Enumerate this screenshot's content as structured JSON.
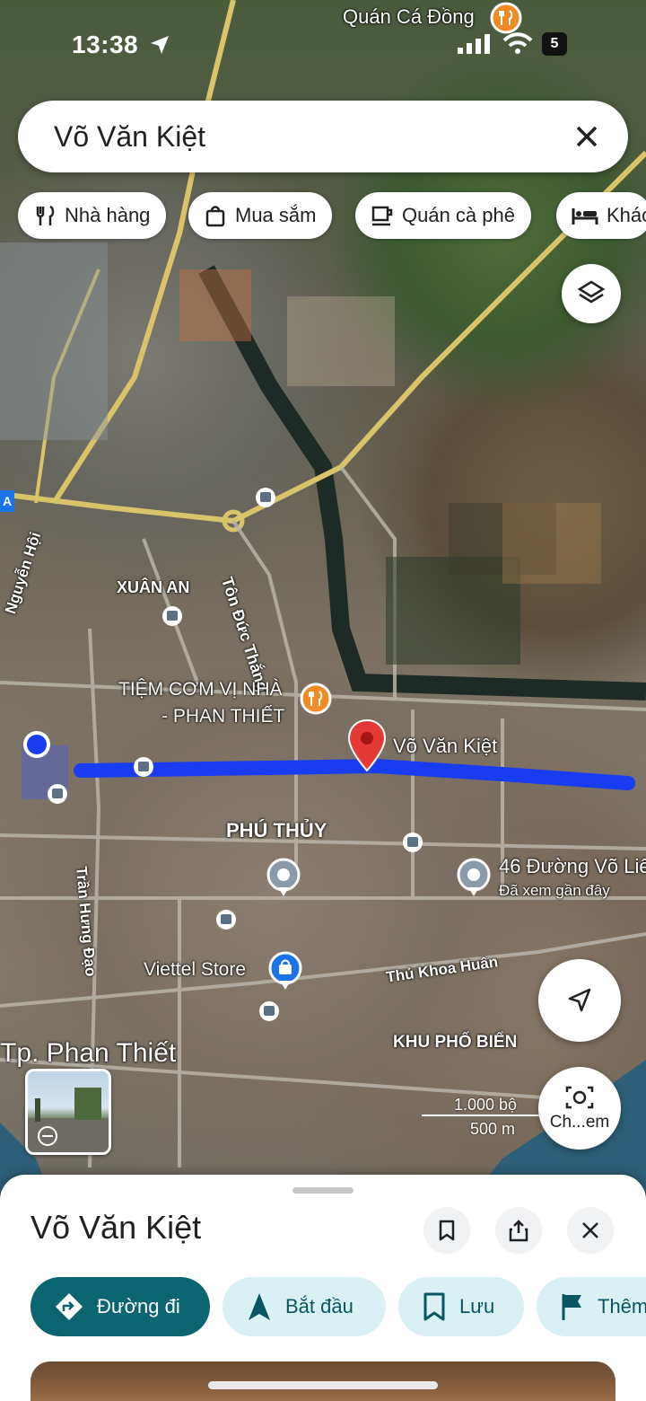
{
  "status_bar": {
    "time": "13:38",
    "battery": "5"
  },
  "search": {
    "query": "Võ Văn Kiệt"
  },
  "chips": [
    {
      "label": "Nhà hàng",
      "icon": "restaurant-icon"
    },
    {
      "label": "Mua sắm",
      "icon": "shopping-bag-icon"
    },
    {
      "label": "Quán cà phê",
      "icon": "coffee-icon"
    },
    {
      "label": "Khác",
      "icon": "hotel-bed-icon"
    }
  ],
  "map": {
    "labels": {
      "quan_ca_dong": "Quán Cá Đồng",
      "xuan_an": "XUÂN AN",
      "ton_duc_thang": "Tôn Đức Thắng",
      "nguyen_hoi": "Nguyễn Hội",
      "tiem_com_1": "TIỆM CƠM VỊ NHÀ",
      "tiem_com_2": "- PHAN THIẾT",
      "vo_van_kiet": "Võ Văn Kiệt",
      "phu_thuy": "PHÚ THỦY",
      "duong_vo_lieu": "46 Đường Võ Liê",
      "da_xem": "Đã xem gần đây",
      "tran_hung_dao": "Trần Hưng Đạo",
      "viettel_store": "Viettel Store",
      "thu_khoa_huan": "Thủ Khoa Huân",
      "tp_phan_thiet": "Tp. Phan Thiết",
      "khu_pho_bien": "KHU PHỐ BIỂN",
      "route_badge": "A"
    },
    "scale": {
      "feet": "1.000 bộ",
      "meters": "500 m"
    },
    "camera_label": "Ch...em",
    "highlight_color": "#1a3cf0",
    "pin_color": "#e53935"
  },
  "sheet": {
    "title": "Võ Văn Kiệt",
    "actions": [
      {
        "label": "Đường đi",
        "icon": "directions-icon"
      },
      {
        "label": "Bắt đầu",
        "icon": "navigation-arrow-icon"
      },
      {
        "label": "Lưu",
        "icon": "bookmark-icon"
      },
      {
        "label": "Thêm",
        "icon": "flag-icon"
      }
    ]
  }
}
